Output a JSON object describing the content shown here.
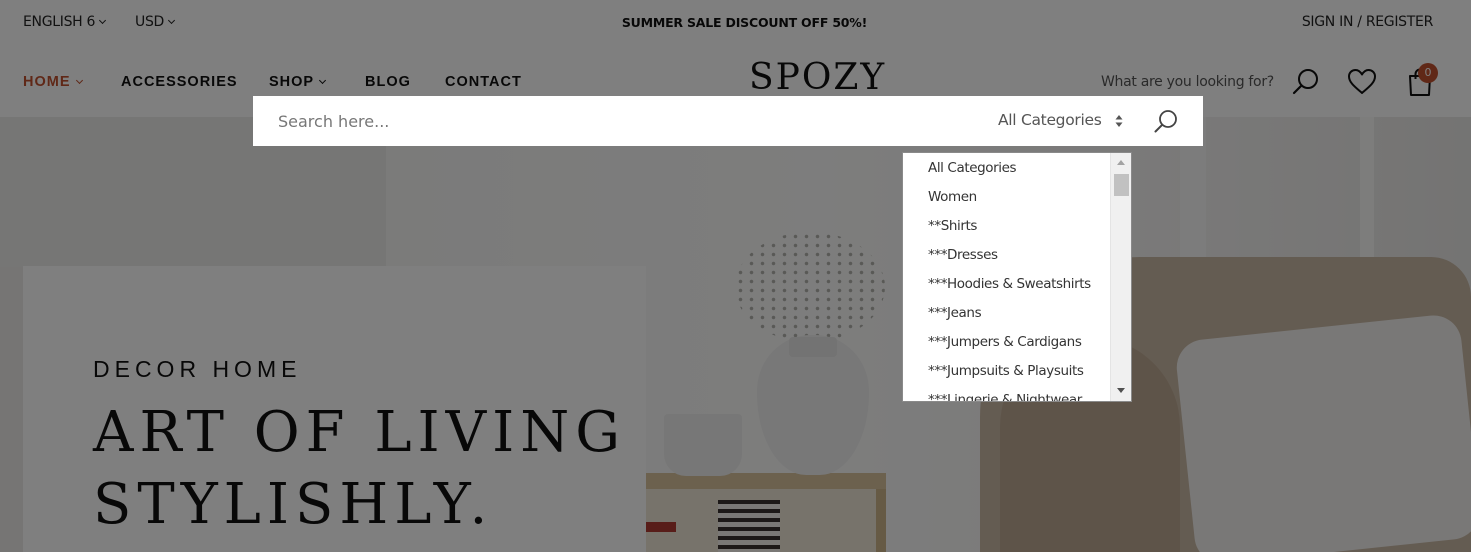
{
  "topbar": {
    "language": "ENGLISH 6",
    "currency": "USD",
    "promo": "SUMMER SALE DISCOUNT OFF 50%!",
    "account": "SIGN IN / REGISTER"
  },
  "nav": {
    "items": [
      {
        "label": "HOME",
        "has_dropdown": true,
        "active": true
      },
      {
        "label": "ACCESSORIES",
        "has_dropdown": false
      },
      {
        "label": "SHOP",
        "has_dropdown": true
      },
      {
        "label": "BLOG",
        "has_dropdown": false
      },
      {
        "label": "CONTACT",
        "has_dropdown": false
      }
    ],
    "logo": "SPOZY",
    "search_placeholder": "What are you looking for?",
    "cart_count": "0",
    "icons": [
      "search-icon",
      "heart-icon",
      "shopping-bag-icon"
    ]
  },
  "hero": {
    "subtitle": "DECOR HOME",
    "title_line1": "ART OF LIVING",
    "title_line2": "STYLISHLY."
  },
  "search_popup": {
    "placeholder": "Search here...",
    "category_selected": "All Categories",
    "category_options": [
      "All Categories",
      "Women",
      "**Shirts",
      "***Dresses",
      "***Hoodies & Sweatshirts",
      "***Jeans",
      "***Jumpers & Cardigans",
      "***Jumpsuits & Playsuits",
      "***Lingerie & Nightwear"
    ]
  },
  "colors": {
    "accent": "#c0512f",
    "overlay": "rgba(0,0,0,0.5)",
    "text": "#111111"
  }
}
